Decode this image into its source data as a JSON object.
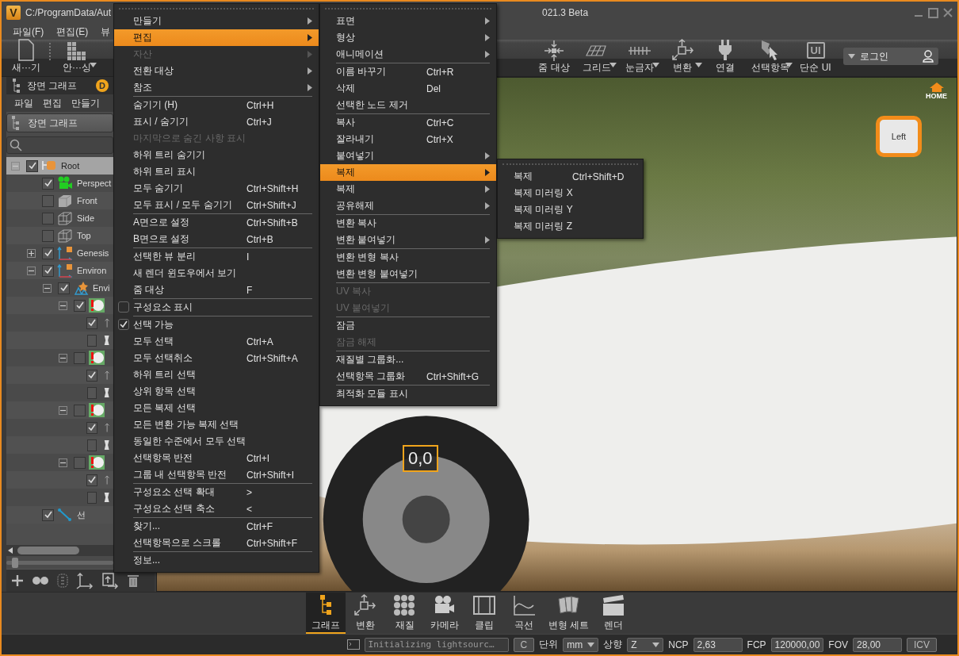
{
  "window": {
    "logo": "V",
    "title_start": "C:/ProgramData/Aut",
    "title_end": "021.3 Beta"
  },
  "menubar": [
    "파일(F)",
    "편집(E)",
    "뷰"
  ],
  "toolbar_left": [
    {
      "kind": "new",
      "label": "새···기",
      "dropdown": false
    },
    {
      "kind": "tiles",
      "label": "안···싱",
      "dropdown": true
    }
  ],
  "toolbar_right": [
    {
      "kind": "zoom",
      "label": "줌 대상",
      "dropdown": false
    },
    {
      "kind": "plane",
      "label": "그리드",
      "dropdown": true
    },
    {
      "kind": "ruler",
      "label": "눈금자",
      "dropdown": true
    },
    {
      "kind": "transform",
      "label": "변환",
      "dropdown": true
    },
    {
      "kind": "plug",
      "label": "연결",
      "dropdown": false
    },
    {
      "kind": "pointer",
      "label": "선택항목",
      "dropdown": true
    },
    {
      "kind": "ui",
      "label": "단순 UI",
      "dropdown": false,
      "badge": "UI"
    }
  ],
  "login": {
    "label": "로그인"
  },
  "scene_graph": {
    "title": "장면 그래프",
    "badge": "D",
    "menu": [
      "파일",
      "편집",
      "만들기"
    ],
    "view_selector": "장면 그래프"
  },
  "tree": [
    {
      "kind": "root",
      "label": "Root",
      "checked": true,
      "selected": true,
      "expanded": true,
      "children": [
        {
          "kind": "camera",
          "label": "Perspect",
          "checked": true,
          "selected": false
        },
        {
          "kind": "cube",
          "label": "Front",
          "checked": false,
          "selected": false
        },
        {
          "kind": "wirecube",
          "label": "Side",
          "checked": false,
          "selected": false
        },
        {
          "kind": "wirecube",
          "label": "Top",
          "checked": false,
          "selected": false
        },
        {
          "kind": "axis",
          "label": "Genesis",
          "checked": true,
          "selected": false,
          "expanded": false
        },
        {
          "kind": "axis",
          "label": "Environ",
          "checked": true,
          "selected": false,
          "expanded": true,
          "children": [
            {
              "kind": "environment",
              "label": "Envi",
              "checked": true,
              "selected": false,
              "expanded": true,
              "children": [
                {
                  "kind": "material",
                  "checked": true,
                  "selected": false,
                  "expanded": true,
                  "children": [
                    {
                      "kind": "light",
                      "checked": true,
                      "selected": false
                    },
                    {
                      "kind": "shape",
                      "checked": false,
                      "selected": false
                    }
                  ]
                },
                {
                  "kind": "material",
                  "checked": false,
                  "selected": false,
                  "expanded": true,
                  "children": [
                    {
                      "kind": "light",
                      "checked": true,
                      "selected": false
                    },
                    {
                      "kind": "shape",
                      "checked": false,
                      "selected": false
                    }
                  ]
                },
                {
                  "kind": "material",
                  "checked": false,
                  "selected": false,
                  "expanded": true,
                  "children": [
                    {
                      "kind": "light",
                      "checked": true,
                      "selected": false
                    },
                    {
                      "kind": "shape",
                      "checked": false,
                      "selected": false
                    }
                  ]
                },
                {
                  "kind": "material",
                  "checked": false,
                  "selected": false,
                  "expanded": true,
                  "children": [
                    {
                      "kind": "light",
                      "checked": true,
                      "selected": false
                    },
                    {
                      "kind": "shape",
                      "checked": false,
                      "selected": false
                    }
                  ]
                }
              ]
            }
          ]
        },
        {
          "kind": "line",
          "label": "선",
          "checked": true,
          "selected": false
        }
      ]
    }
  ],
  "zoom_slider": {
    "level": 0.05
  },
  "viewport": {
    "home_label": "HOME",
    "view_cube_label": "Left",
    "coordinate_label": "0,0"
  },
  "context_menu": {
    "items": [
      {
        "kind": "item",
        "label": "만들기",
        "submenu": true,
        "disabled": false,
        "selected": false
      },
      {
        "kind": "item",
        "label": "편집",
        "submenu": true,
        "disabled": false,
        "selected": true
      },
      {
        "kind": "item",
        "label": "자산",
        "submenu": true,
        "disabled": true,
        "selected": false
      },
      {
        "kind": "item",
        "label": "전환 대상",
        "submenu": true,
        "disabled": false,
        "selected": false
      },
      {
        "kind": "item",
        "label": "참조",
        "submenu": true,
        "disabled": false,
        "selected": false
      },
      {
        "kind": "separator"
      },
      {
        "kind": "item",
        "label": "숨기기 (H)",
        "shortcut": "Ctrl+H",
        "submenu": false,
        "disabled": false,
        "selected": false
      },
      {
        "kind": "item",
        "label": "표시 / 숨기기",
        "shortcut": "Ctrl+J",
        "submenu": false,
        "disabled": false,
        "selected": false
      },
      {
        "kind": "item",
        "label": "마지막으로 숨긴 사항 표시",
        "submenu": false,
        "disabled": true,
        "selected": false
      },
      {
        "kind": "item",
        "label": "하위 트리 숨기기",
        "submenu": false,
        "disabled": false,
        "selected": false
      },
      {
        "kind": "item",
        "label": "하위 트리 표시",
        "submenu": false,
        "disabled": false,
        "selected": false
      },
      {
        "kind": "item",
        "label": "모두 숨기기",
        "shortcut": "Ctrl+Shift+H",
        "submenu": false,
        "disabled": false,
        "selected": false
      },
      {
        "kind": "item",
        "label": "모두 표시 / 모두 숨기기",
        "shortcut": "Ctrl+Shift+J",
        "submenu": false,
        "disabled": false,
        "selected": false
      },
      {
        "kind": "separator"
      },
      {
        "kind": "item",
        "label": "A면으로 설정",
        "shortcut": "Ctrl+Shift+B",
        "submenu": false,
        "disabled": false,
        "selected": false
      },
      {
        "kind": "item",
        "label": "B면으로 설정",
        "shortcut": "Ctrl+B",
        "submenu": false,
        "disabled": false,
        "selected": false
      },
      {
        "kind": "separator"
      },
      {
        "kind": "item",
        "label": "선택한 뷰 분리",
        "shortcut": "I",
        "submenu": false,
        "disabled": false,
        "selected": false
      },
      {
        "kind": "item",
        "label": "새 렌더 윈도우에서 보기",
        "submenu": false,
        "disabled": false,
        "selected": false
      },
      {
        "kind": "item",
        "label": "줌 대상",
        "shortcut": "F",
        "submenu": false,
        "disabled": false,
        "selected": false
      },
      {
        "kind": "separator"
      },
      {
        "kind": "check",
        "label": "구성요소 표시",
        "checked": false
      },
      {
        "kind": "separator"
      },
      {
        "kind": "check",
        "label": "선택 가능",
        "checked": true
      },
      {
        "kind": "item",
        "label": "모두 선택",
        "shortcut": "Ctrl+A",
        "submenu": false,
        "disabled": false,
        "selected": false
      },
      {
        "kind": "item",
        "label": "모두 선택취소",
        "shortcut": "Ctrl+Shift+A",
        "submenu": false,
        "disabled": false,
        "selected": false
      },
      {
        "kind": "item",
        "label": "하위 트리 선택",
        "submenu": false,
        "disabled": false,
        "selected": false
      },
      {
        "kind": "item",
        "label": "상위 항목 선택",
        "submenu": false,
        "disabled": false,
        "selected": false
      },
      {
        "kind": "item",
        "label": "모든 복제 선택",
        "submenu": false,
        "disabled": false,
        "selected": false
      },
      {
        "kind": "item",
        "label": "모든 변환 가능 복제 선택",
        "submenu": false,
        "disabled": false,
        "selected": false
      },
      {
        "kind": "item",
        "label": "동일한 수준에서 모두 선택",
        "submenu": false,
        "disabled": false,
        "selected": false
      },
      {
        "kind": "item",
        "label": "선택항목 반전",
        "shortcut": "Ctrl+I",
        "submenu": false,
        "disabled": false,
        "selected": false
      },
      {
        "kind": "item",
        "label": "그룹 내 선택항목 반전",
        "shortcut": "Ctrl+Shift+I",
        "submenu": false,
        "disabled": false,
        "selected": false
      },
      {
        "kind": "separator"
      },
      {
        "kind": "item",
        "label": "구성요소 선택 확대",
        "shortcut": ">",
        "submenu": false,
        "disabled": false,
        "selected": false
      },
      {
        "kind": "item",
        "label": "구성요소 선택 축소",
        "shortcut": "<",
        "submenu": false,
        "disabled": false,
        "selected": false
      },
      {
        "kind": "separator"
      },
      {
        "kind": "item",
        "label": "찾기...",
        "shortcut": "Ctrl+F",
        "submenu": false,
        "disabled": false,
        "selected": false
      },
      {
        "kind": "item",
        "label": "선택항목으로 스크롤",
        "shortcut": "Ctrl+Shift+F",
        "submenu": false,
        "disabled": false,
        "selected": false
      },
      {
        "kind": "separator"
      },
      {
        "kind": "item",
        "label": "정보...",
        "submenu": false,
        "disabled": false,
        "selected": false
      }
    ]
  },
  "edit_submenu": {
    "items": [
      {
        "kind": "item",
        "label": "표면",
        "submenu": true,
        "disabled": false,
        "selected": false
      },
      {
        "kind": "item",
        "label": "형상",
        "submenu": true,
        "disabled": false,
        "selected": false
      },
      {
        "kind": "item",
        "label": "애니메이션",
        "submenu": true,
        "disabled": false,
        "selected": false
      },
      {
        "kind": "separator"
      },
      {
        "kind": "item",
        "label": "이름 바꾸기",
        "shortcut": "Ctrl+R",
        "submenu": false,
        "disabled": false,
        "selected": false
      },
      {
        "kind": "item",
        "label": "삭제",
        "shortcut": "Del",
        "submenu": false,
        "disabled": false,
        "selected": false
      },
      {
        "kind": "item",
        "label": "선택한 노드 제거",
        "submenu": false,
        "disabled": false,
        "selected": false
      },
      {
        "kind": "separator"
      },
      {
        "kind": "item",
        "label": "복사",
        "shortcut": "Ctrl+C",
        "submenu": false,
        "disabled": false,
        "selected": false
      },
      {
        "kind": "item",
        "label": "잘라내기",
        "shortcut": "Ctrl+X",
        "submenu": false,
        "disabled": false,
        "selected": false
      },
      {
        "kind": "item",
        "label": "붙여넣기",
        "submenu": true,
        "disabled": false,
        "selected": false
      },
      {
        "kind": "item",
        "label": "복제",
        "submenu": true,
        "disabled": false,
        "selected": true
      },
      {
        "kind": "item",
        "label": "복제",
        "submenu": true,
        "disabled": false,
        "selected": false
      },
      {
        "kind": "item",
        "label": "공유해제",
        "submenu": true,
        "disabled": false,
        "selected": false
      },
      {
        "kind": "separator"
      },
      {
        "kind": "item",
        "label": "변환 복사",
        "submenu": false,
        "disabled": false,
        "selected": false
      },
      {
        "kind": "item",
        "label": "변환 붙여넣기",
        "submenu": true,
        "disabled": false,
        "selected": false
      },
      {
        "kind": "separator"
      },
      {
        "kind": "item",
        "label": "변환 변형 복사",
        "submenu": false,
        "disabled": false,
        "selected": false
      },
      {
        "kind": "item",
        "label": "변환 변형 붙여넣기",
        "submenu": false,
        "disabled": false,
        "selected": false
      },
      {
        "kind": "separator"
      },
      {
        "kind": "item",
        "label": "UV 복사",
        "submenu": false,
        "disabled": true,
        "selected": false
      },
      {
        "kind": "item",
        "label": "UV 붙여넣기",
        "submenu": false,
        "disabled": true,
        "selected": false
      },
      {
        "kind": "separator"
      },
      {
        "kind": "item",
        "label": "잠금",
        "submenu": false,
        "disabled": false,
        "selected": false
      },
      {
        "kind": "item",
        "label": "잠금 해제",
        "submenu": false,
        "disabled": true,
        "selected": false
      },
      {
        "kind": "separator"
      },
      {
        "kind": "item",
        "label": "재질별 그룹화...",
        "submenu": false,
        "disabled": false,
        "selected": false
      },
      {
        "kind": "item",
        "label": "선택항목 그룹화",
        "shortcut": "Ctrl+Shift+G",
        "submenu": false,
        "disabled": false,
        "selected": false
      },
      {
        "kind": "separator"
      },
      {
        "kind": "item",
        "label": "최적화 모듈 표시",
        "submenu": false,
        "disabled": false,
        "selected": false
      }
    ]
  },
  "duplicate_submenu": {
    "items": [
      {
        "kind": "item",
        "label": "복제",
        "shortcut": "Ctrl+Shift+D",
        "submenu": false,
        "disabled": false,
        "selected": false
      },
      {
        "kind": "item",
        "label": "복제 미러링 X",
        "submenu": false,
        "disabled": false,
        "selected": false
      },
      {
        "kind": "item",
        "label": "복제 미러링 Y",
        "submenu": false,
        "disabled": false,
        "selected": false
      },
      {
        "kind": "item",
        "label": "복제 미러링 Z",
        "submenu": false,
        "disabled": false,
        "selected": false
      }
    ]
  },
  "dock_tabs": [
    {
      "kind": "graph",
      "label": "그래프",
      "selected": true
    },
    {
      "kind": "transform",
      "label": "변환",
      "selected": false
    },
    {
      "kind": "material",
      "label": "재질",
      "selected": false
    },
    {
      "kind": "camera",
      "label": "카메라",
      "selected": false
    },
    {
      "kind": "clip",
      "label": "클립",
      "selected": false
    },
    {
      "kind": "curve",
      "label": "곡선",
      "selected": false
    },
    {
      "kind": "variant",
      "label": "변형 세트",
      "selected": false
    },
    {
      "kind": "render",
      "label": "렌더",
      "selected": false
    }
  ],
  "status_bar": {
    "console": "Initializing lightsourc…",
    "clear_button": "C",
    "unit_label": "단위",
    "unit": "mm",
    "up_label": "상향",
    "up": "Z",
    "ncp_label": "NCP",
    "ncp": "2,63",
    "fcp_label": "FCP",
    "fcp": "120000,00",
    "fov_label": "FOV",
    "fov": "28,00",
    "icv_button": "ICV"
  }
}
